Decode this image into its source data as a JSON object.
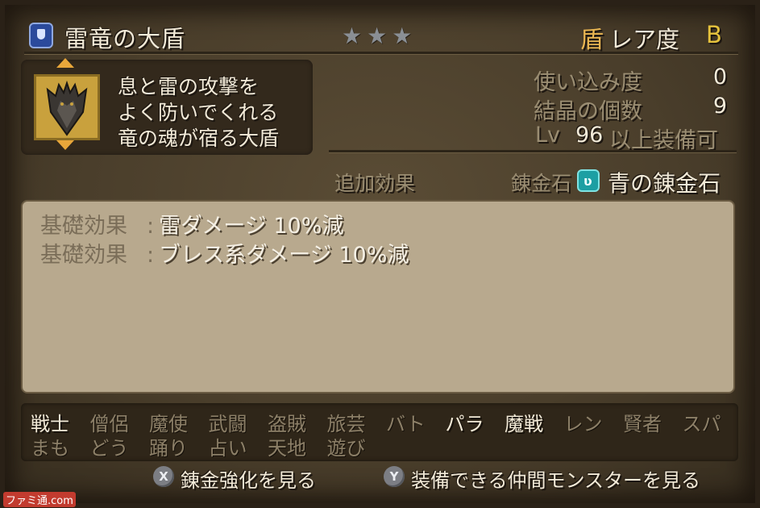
{
  "header": {
    "item_name": "雷竜の大盾",
    "stars": "★★★",
    "rarity_icon": "盾",
    "rarity_label": "レア度",
    "rarity_value": "B"
  },
  "description": {
    "lines": [
      "息と雷の攻撃を",
      "よく防いでくれる",
      "竜の魂が宿る大盾"
    ]
  },
  "stats": {
    "usage_label": "使い込み度",
    "usage_value": "0",
    "crystal_label": "結晶の個数",
    "crystal_value": "9",
    "lv_prefix": "Lv",
    "lv_value": "96",
    "lv_suffix": "以上装備可"
  },
  "extra": {
    "extra_label": "追加効果",
    "alchemy_label": "錬金石",
    "alchemy_value": "青の錬金石"
  },
  "effects": [
    {
      "label": "基礎効果",
      "colon": ":",
      "value": "雷ダメージ 10%減"
    },
    {
      "label": "基礎効果",
      "colon": ":",
      "value": "ブレス系ダメージ 10%減"
    }
  ],
  "jobs": {
    "row1": [
      {
        "name": "戦士",
        "on": true
      },
      {
        "name": "僧侶",
        "on": false
      },
      {
        "name": "魔使",
        "on": false
      },
      {
        "name": "武闘",
        "on": false
      },
      {
        "name": "盗賊",
        "on": false
      },
      {
        "name": "旅芸",
        "on": false
      },
      {
        "name": "バト",
        "on": false
      },
      {
        "name": "パラ",
        "on": true
      },
      {
        "name": "魔戦",
        "on": true
      },
      {
        "name": "レン",
        "on": false
      },
      {
        "name": "賢者",
        "on": false
      },
      {
        "name": "スパ",
        "on": false
      }
    ],
    "row2": [
      {
        "name": "まも",
        "on": false
      },
      {
        "name": "どう",
        "on": false
      },
      {
        "name": "踊り",
        "on": false
      },
      {
        "name": "占い",
        "on": false
      },
      {
        "name": "天地",
        "on": false
      },
      {
        "name": "遊び",
        "on": false
      }
    ]
  },
  "footer": {
    "x_button": "X",
    "x_label": "錬金強化を見る",
    "y_button": "Y",
    "y_label": "装備できる仲間モンスターを見る"
  },
  "watermark": "ファミ通.com",
  "colors": {
    "background": "#4a3e2b",
    "panel": "#33291c",
    "effects_panel": "#b8a98e",
    "accent_gold": "#e9b652",
    "rarity_b": "#e5c23c",
    "alchemy_teal": "#1c9fa3"
  }
}
